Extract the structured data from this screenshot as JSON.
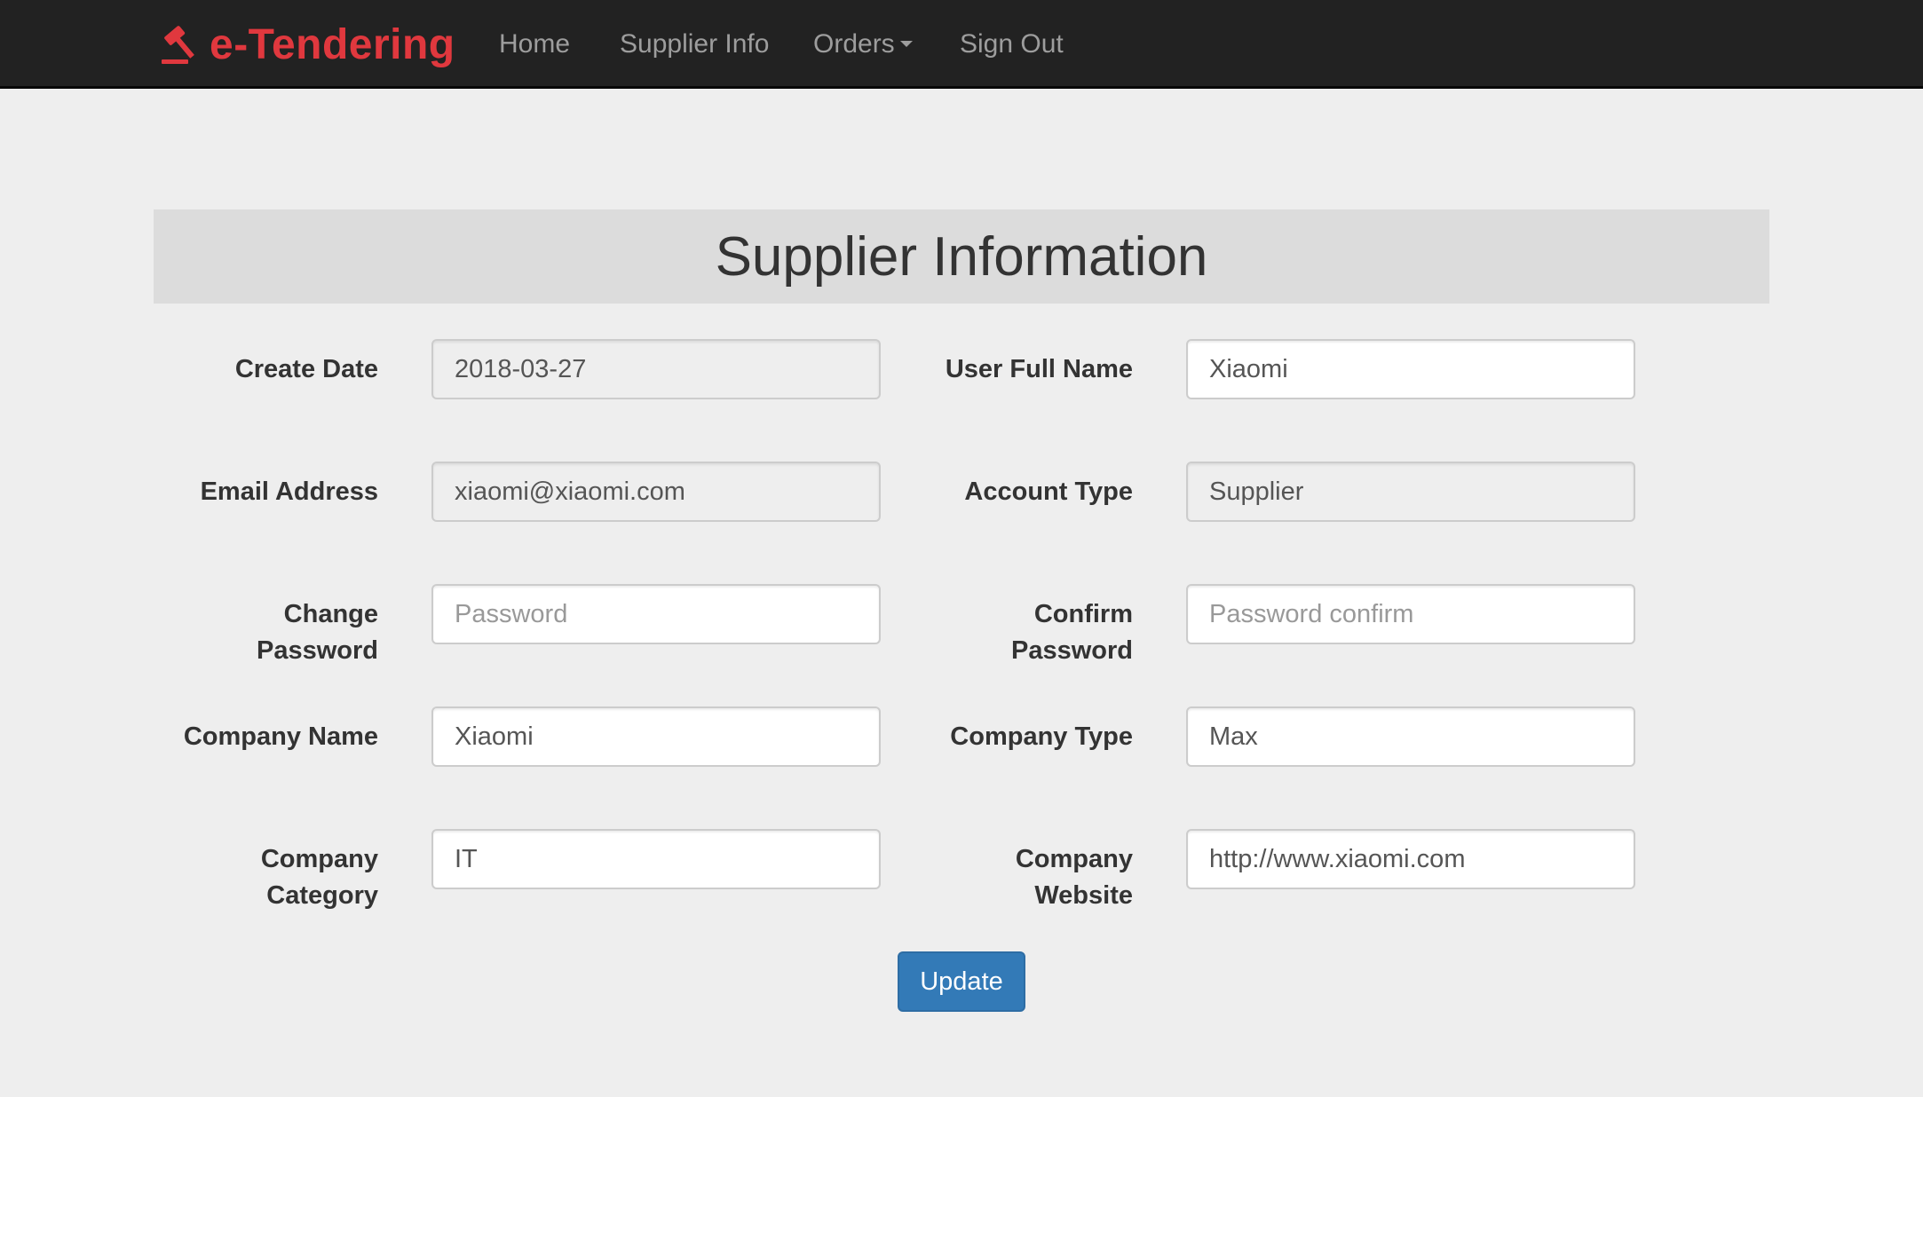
{
  "navbar": {
    "brand": "e-Tendering",
    "brand_color": "#e0383e",
    "brand_icon": "gavel-icon",
    "items": [
      {
        "label": "Home"
      },
      {
        "label": "Supplier Info"
      },
      {
        "label": "Orders"
      },
      {
        "label": "Sign Out"
      }
    ]
  },
  "page": {
    "title": "Supplier Information"
  },
  "form": {
    "create_date": {
      "label": "Create Date",
      "value": "2018-03-27"
    },
    "user_full_name": {
      "label": "User Full Name",
      "value": "Xiaomi"
    },
    "email": {
      "label": "Email Address",
      "value": "xiaomi@xiaomi.com"
    },
    "account_type": {
      "label": "Account Type",
      "value": "Supplier"
    },
    "change_password": {
      "label_line1": "Change",
      "label_line2": "Password",
      "value": "",
      "placeholder": "Password"
    },
    "confirm_password": {
      "label_line1": "Confirm",
      "label_line2": "Password",
      "value": "",
      "placeholder": "Password confirm"
    },
    "company_name": {
      "label": "Company Name",
      "value": "Xiaomi"
    },
    "company_type": {
      "label": "Company Type",
      "value": "Max"
    },
    "company_category": {
      "label_line1": "Company",
      "label_line2": "Category",
      "value": "IT"
    },
    "company_website": {
      "label_line1": "Company",
      "label_line2": "Website",
      "value": "http://www.xiaomi.com"
    },
    "update_label": "Update"
  },
  "colors": {
    "navbar_bg": "#222222",
    "nav_text": "#9d9d9d",
    "primary_button": "#337ab7",
    "page_bg": "#eeeeee",
    "header_bar": "#dcdcdc"
  }
}
